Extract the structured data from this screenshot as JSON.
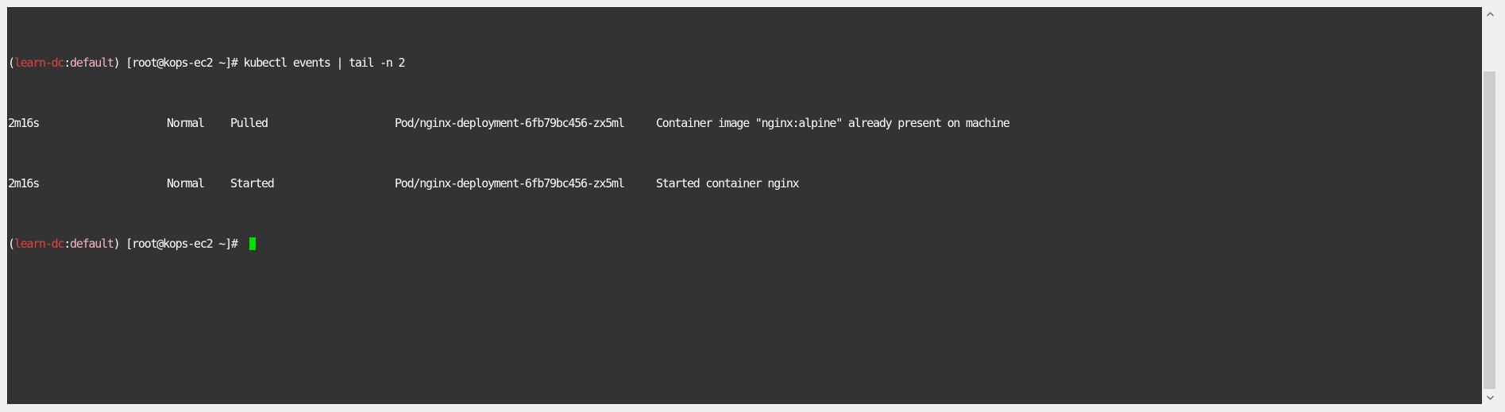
{
  "terminal": {
    "prompt": {
      "open_paren": "(",
      "cluster": "learn-dc",
      "separator": ":",
      "namespace": "default",
      "close_paren": ")",
      "user_host": " [root@kops-ec2 ~]# "
    },
    "command": "kubectl events | tail -n 2",
    "events": [
      {
        "last_seen": "2m16s",
        "type": "Normal",
        "reason": "Pulled",
        "object": "Pod/nginx-deployment-6fb79bc456-zx5ml",
        "message": "Container image \"nginx:alpine\" already present on machine"
      },
      {
        "last_seen": "2m16s",
        "type": "Normal",
        "reason": "Started",
        "object": "Pod/nginx-deployment-6fb79bc456-zx5ml",
        "message": "Started container nginx"
      }
    ]
  },
  "scrollbar": {
    "up_icon": "chevron-up-icon",
    "down_icon": "chevron-down-icon"
  },
  "colors": {
    "background": "#333333",
    "foreground": "#ffffff",
    "cluster": "#e0443c",
    "namespace": "#f7b7bd",
    "cursor": "#00e000"
  }
}
